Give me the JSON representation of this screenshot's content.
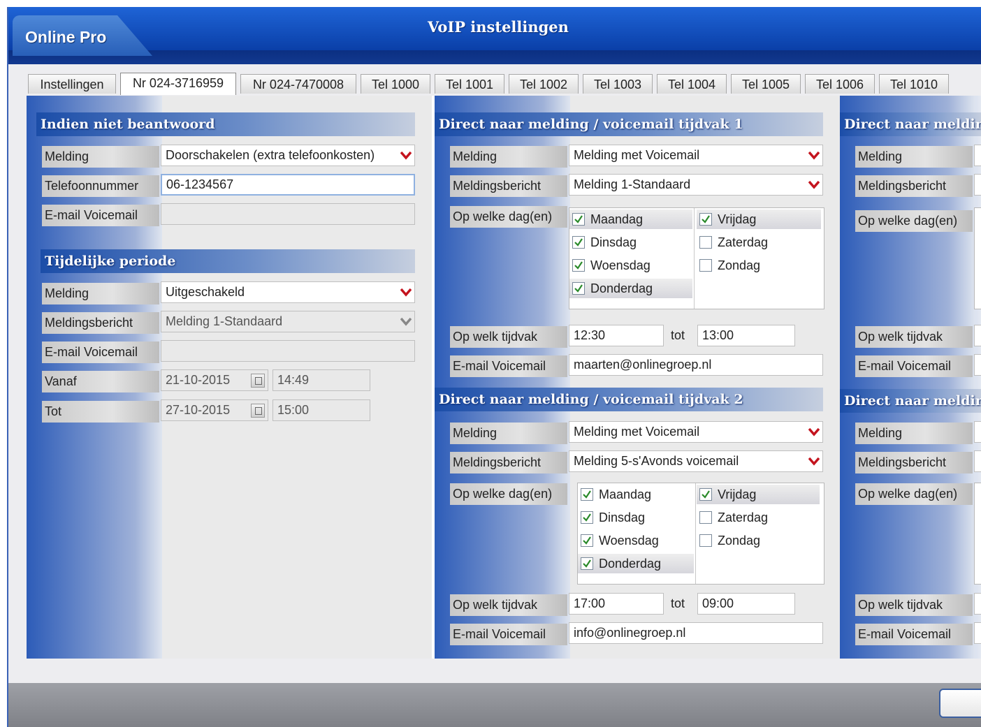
{
  "app": {
    "name": "Online Pro",
    "title": "VoIP instellingen"
  },
  "tabs": [
    "Instellingen",
    "Nr 024-3716959",
    "Nr 024-7470008",
    "Tel 1000",
    "Tel 1001",
    "Tel 1002",
    "Tel 1003",
    "Tel 1004",
    "Tel 1005",
    "Tel 1006",
    "Tel 1010"
  ],
  "active_tab": "Nr 024-3716959",
  "unanswered": {
    "header": "Indien niet beantwoord",
    "melding_label": "Melding",
    "melding_value": "Doorschakelen (extra telefoonkosten)",
    "phone_label": "Telefoonnummer",
    "phone_value": "06-1234567",
    "email_label": "E-mail Voicemail",
    "email_value": ""
  },
  "temporary": {
    "header": "Tijdelijke periode",
    "melding_label": "Melding",
    "melding_value": "Uitgeschakeld",
    "bericht_label": "Meldingsbericht",
    "bericht_value": "Melding 1-Standaard",
    "email_label": "E-mail Voicemail",
    "email_value": "",
    "from_label": "Vanaf",
    "from_date": "21-10-2015",
    "from_time": "14:49",
    "to_label": "Tot",
    "to_date": "27-10-2015",
    "to_time": "15:00"
  },
  "slot1": {
    "header": "Direct naar melding / voicemail tijdvak 1",
    "melding_label": "Melding",
    "melding_value": "Melding met Voicemail",
    "bericht_label": "Meldingsbericht",
    "bericht_value": "Melding 1-Standaard",
    "days_label": "Op welke dag(en)",
    "days": [
      {
        "name": "Maandag",
        "checked": true
      },
      {
        "name": "Dinsdag",
        "checked": true
      },
      {
        "name": "Woensdag",
        "checked": true
      },
      {
        "name": "Donderdag",
        "checked": true
      },
      {
        "name": "Vrijdag",
        "checked": true
      },
      {
        "name": "Zaterdag",
        "checked": false
      },
      {
        "name": "Zondag",
        "checked": false
      }
    ],
    "time_label": "Op welk tijdvak",
    "time_from": "12:30",
    "tot_label": "tot",
    "time_to": "13:00",
    "email_label": "E-mail Voicemail",
    "email_value": "maarten@onlinegroep.nl"
  },
  "slot2": {
    "header": "Direct naar melding / voicemail tijdvak 2",
    "melding_label": "Melding",
    "melding_value": "Melding met Voicemail",
    "bericht_label": "Meldingsbericht",
    "bericht_value": "Melding 5-s'Avonds voicemail",
    "days_label": "Op welke dag(en)",
    "days": [
      {
        "name": "Maandag",
        "checked": true
      },
      {
        "name": "Dinsdag",
        "checked": true
      },
      {
        "name": "Woensdag",
        "checked": true
      },
      {
        "name": "Donderdag",
        "checked": true
      },
      {
        "name": "Vrijdag",
        "checked": true
      },
      {
        "name": "Zaterdag",
        "checked": false
      },
      {
        "name": "Zondag",
        "checked": false
      }
    ],
    "time_label": "Op welk tijdvak",
    "time_from": "17:00",
    "tot_label": "tot",
    "time_to": "09:00",
    "email_label": "E-mail Voicemail",
    "email_value": "info@onlinegroep.nl"
  },
  "col3": {
    "header1": "Direct naar meldin",
    "header2": "Direct naar meldin",
    "melding_label": "Melding",
    "bericht_label": "Meldingsbericht",
    "days_label": "Op welke dag(en)",
    "time_label": "Op welk tijdvak",
    "email_label": "E-mail Voicemail"
  }
}
